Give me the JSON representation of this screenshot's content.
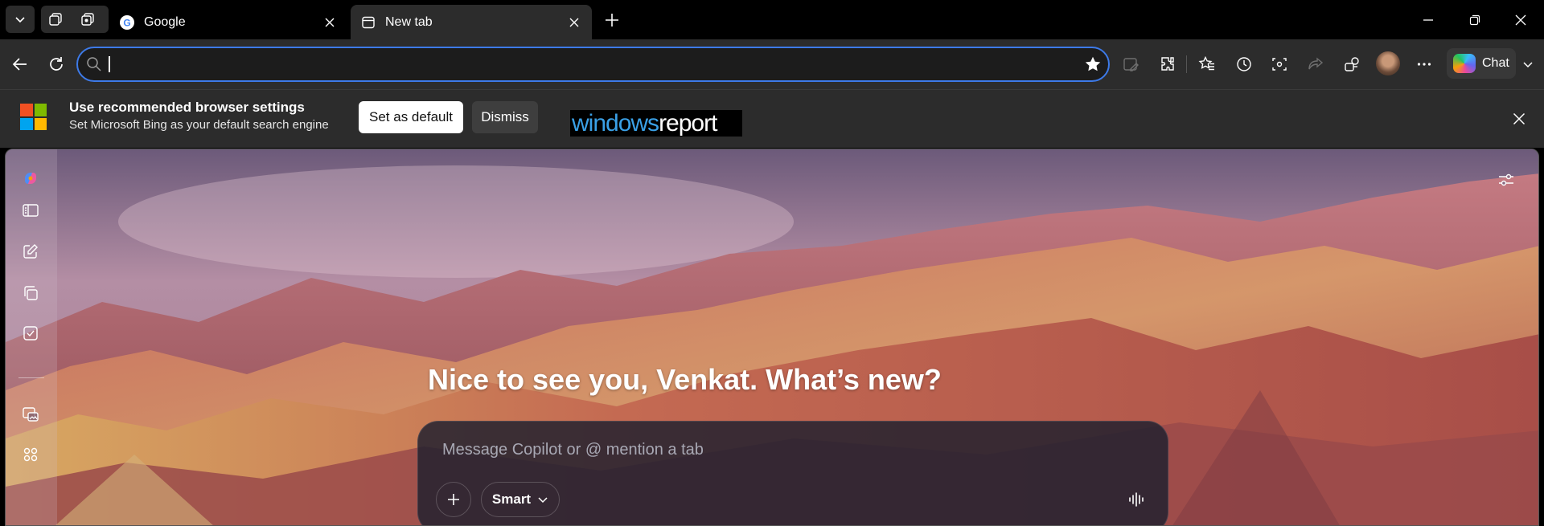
{
  "tabs": [
    {
      "title": "Google",
      "favicon": "google-icon",
      "active": false
    },
    {
      "title": "New tab",
      "favicon": "new-tab-icon",
      "active": true
    }
  ],
  "address_bar": {
    "value": "",
    "placeholder": ""
  },
  "toolbar": {
    "chat_label": "Chat"
  },
  "infobar": {
    "title": "Use recommended browser settings",
    "subtitle": "Set Microsoft Bing as your default search engine",
    "set_default_label": "Set as default",
    "dismiss_label": "Dismiss",
    "watermark_left": "windows",
    "watermark_right": "report"
  },
  "page": {
    "greeting": "Nice to see you, Venkat. What’s new?",
    "composer_placeholder": "Message Copilot or @ mention a tab",
    "mode_label": "Smart"
  },
  "colors": {
    "accent_focus": "#3d7ae8",
    "toolbar_bg": "#2c2c2c",
    "tabstrip_bg": "#000000"
  }
}
